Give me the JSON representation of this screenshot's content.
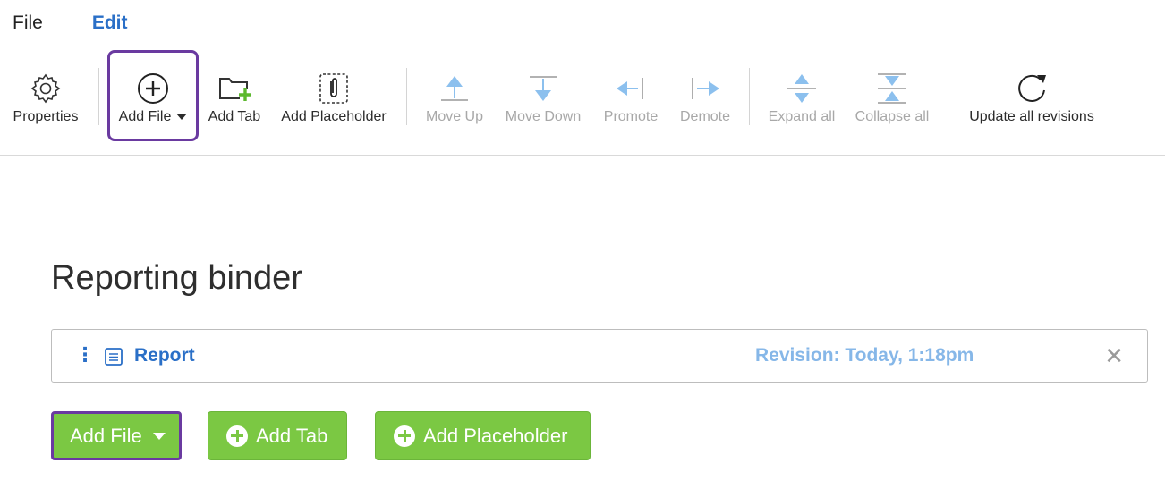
{
  "menu": {
    "file": "File",
    "edit": "Edit"
  },
  "toolbar": {
    "properties": "Properties",
    "add_file": "Add File",
    "add_tab": "Add Tab",
    "add_placeholder": "Add Placeholder",
    "move_up": "Move Up",
    "move_down": "Move Down",
    "promote": "Promote",
    "demote": "Demote",
    "expand_all": "Expand all",
    "collapse_all": "Collapse all",
    "update_all_revisions": "Update all revisions"
  },
  "main": {
    "title": "Reporting binder",
    "items": [
      {
        "name": "Report",
        "revision": "Revision: Today, 1:18pm"
      }
    ]
  },
  "actions": {
    "add_file": "Add File",
    "add_tab": "Add Tab",
    "add_placeholder": "Add Placeholder"
  },
  "colors": {
    "accent": "#2a6fc7",
    "revision": "#86b7e8",
    "green": "#7bc843",
    "highlight": "#6a3aa0"
  }
}
